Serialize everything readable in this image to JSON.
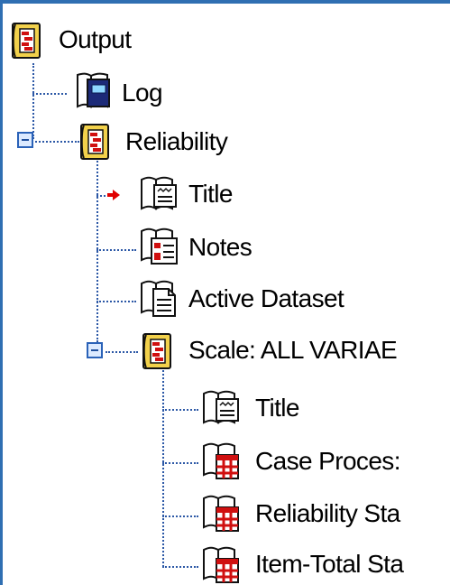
{
  "tree": {
    "root": {
      "label": "Output",
      "icon": "output-book-icon"
    },
    "log": {
      "label": "Log",
      "icon": "log-book-icon"
    },
    "reliability": {
      "label": "Reliability",
      "icon": "output-book-icon"
    },
    "title": {
      "label": "Title",
      "icon": "title-icon"
    },
    "notes": {
      "label": "Notes",
      "icon": "notes-icon"
    },
    "active_dataset": {
      "label": "Active Dataset",
      "icon": "document-icon"
    },
    "scale": {
      "label": "Scale: ALL VARIAE",
      "icon": "output-book-icon"
    },
    "scale_title": {
      "label": "Title",
      "icon": "title-icon"
    },
    "case_processing": {
      "label": "Case Proces:",
      "icon": "table-icon"
    },
    "reliability_statistics": {
      "label": "Reliability Sta",
      "icon": "table-icon"
    },
    "item_total_statistics": {
      "label": "Item-Total Sta",
      "icon": "table-icon"
    }
  },
  "colors": {
    "accent": "#2f6fb2",
    "tree_line": "#2c58a6",
    "selected_arrow": "#e00000"
  }
}
